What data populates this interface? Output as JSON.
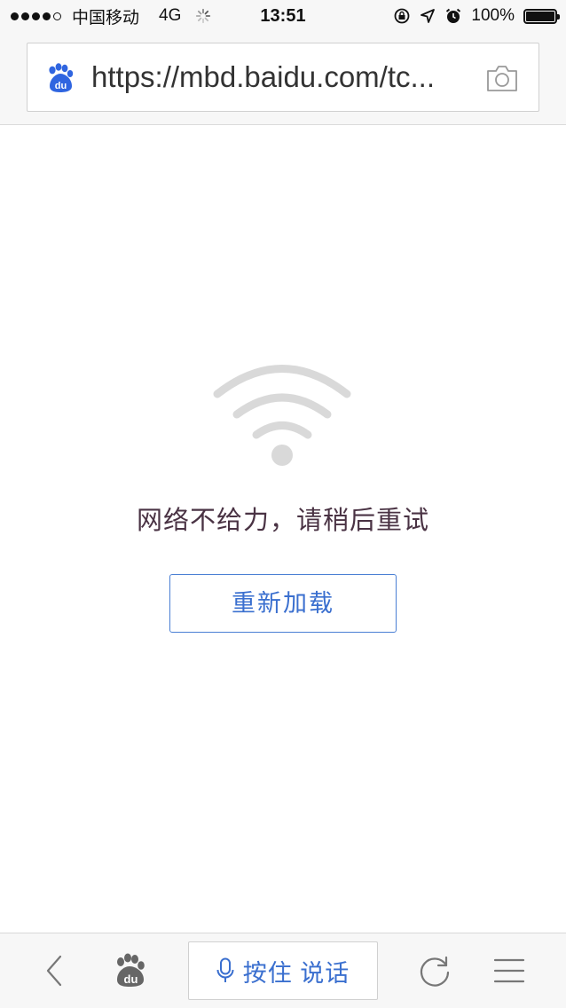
{
  "status_bar": {
    "signal_dots": [
      true,
      true,
      true,
      true,
      false
    ],
    "carrier": "中国移动",
    "network": "4G",
    "time": "13:51",
    "battery_percent": "100%",
    "battery_level": 1.0,
    "icons": [
      "rotation-lock-icon",
      "location-arrow-icon",
      "alarm-icon"
    ]
  },
  "url_bar": {
    "url": "https://mbd.baidu.com/tc...",
    "logo_icon": "baidu-paw-icon",
    "camera_icon": "camera-icon"
  },
  "error_page": {
    "icon": "wifi-icon",
    "message": "网络不给力，请稍后重试",
    "reload_label": "重新加载"
  },
  "bottom_toolbar": {
    "back_icon": "back-chevron-icon",
    "home_icon": "baidu-paw-icon",
    "voice_label": "按住 说话",
    "voice_icon": "microphone-icon",
    "refresh_icon": "refresh-icon",
    "menu_icon": "hamburger-menu-icon"
  },
  "colors": {
    "accent_blue": "#3a6fcf",
    "baidu_blue": "#2f65e0",
    "wifi_gray": "#d9d9d9",
    "message_text": "#4a3344",
    "bar_background": "#f7f7f7"
  }
}
